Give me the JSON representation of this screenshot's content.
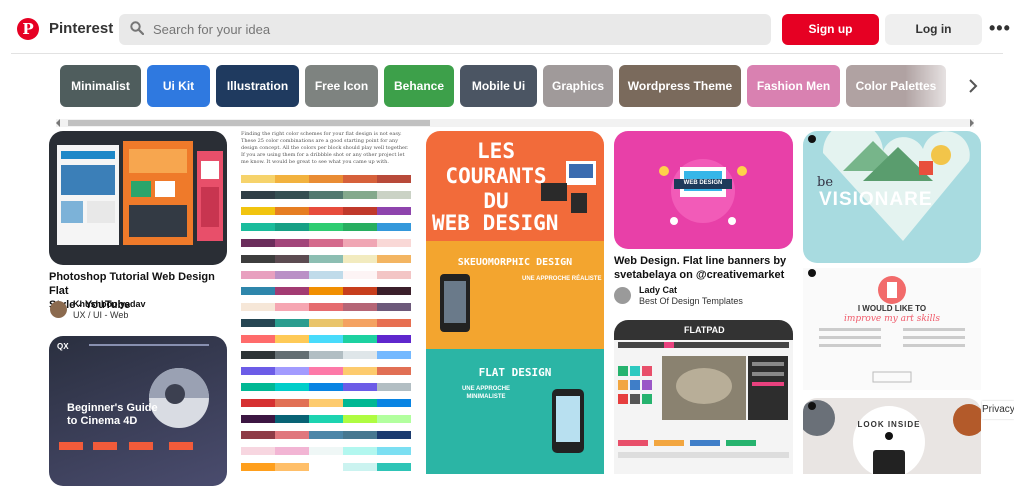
{
  "header": {
    "brand": "Pinterest",
    "search_placeholder": "Search for your idea",
    "signup_label": "Sign up",
    "login_label": "Log in",
    "more_label": "•••"
  },
  "categories": [
    {
      "label": "Minimalist",
      "color": "#4f5d5d"
    },
    {
      "label": "Ui Kit",
      "color": "#2f79e0"
    },
    {
      "label": "Illustration",
      "color": "#1f3a5f"
    },
    {
      "label": "Free Icon",
      "color": "#7e8380"
    },
    {
      "label": "Behance",
      "color": "#3da04a"
    },
    {
      "label": "Mobile Ui",
      "color": "#4b5563"
    },
    {
      "label": "Graphics",
      "color": "#a09a9a"
    },
    {
      "label": "Wordpress Theme",
      "color": "#7a6a5c"
    },
    {
      "label": "Fashion Men",
      "color": "#d981b1"
    },
    {
      "label": "Color Palettes",
      "color": "#b0a2a2"
    }
  ],
  "pins": {
    "p1": {
      "title_line1": "Photoshop Tutorial Web Design Flat",
      "title_line2": "Style - YouTube",
      "user": "Khushboo yadav",
      "board": "UX / UI - Web"
    },
    "p2": {
      "heading": "Beginner's Guide",
      "heading2": "to Cinema 4D",
      "badge": "QX"
    },
    "p3": {
      "text": "Finding the right color schemes for your flat design is not easy. These 25 color combinations are a good starting point for any design concept. All the colors per block should play well together. If you are using them for a dribbble shot or any other project let me know. It would be great to see what you came up with."
    },
    "p4": {
      "line1": "LES",
      "line2": "COURANTS",
      "line3": "DU",
      "line4": "WEB DESIGN",
      "sub1": "SKEUOMORPHIC DESIGN",
      "sub1_tag": "UNE APPROCHE RÉALISTE",
      "sub2": "FLAT DESIGN",
      "sub2_tag1": "UNE APPROCHE",
      "sub2_tag2": "MINIMALISTE"
    },
    "p5": {
      "title_line1": "Web Design. Flat line banners by",
      "title_line2": "svetabelaya on @creativemarket",
      "user": "Lady Cat",
      "board": "Best Of Design Templates",
      "badge": "WEB DESIGN"
    },
    "p6": {
      "title": "FLATPAD"
    },
    "p7": {
      "be": "be",
      "word": "VISIONARE",
      "line1": "I WOULD LIKE TO",
      "line2": "improve my art skills"
    },
    "p8": {
      "title": "LOOK INSIDE"
    }
  },
  "privacy_label": "Privacy"
}
